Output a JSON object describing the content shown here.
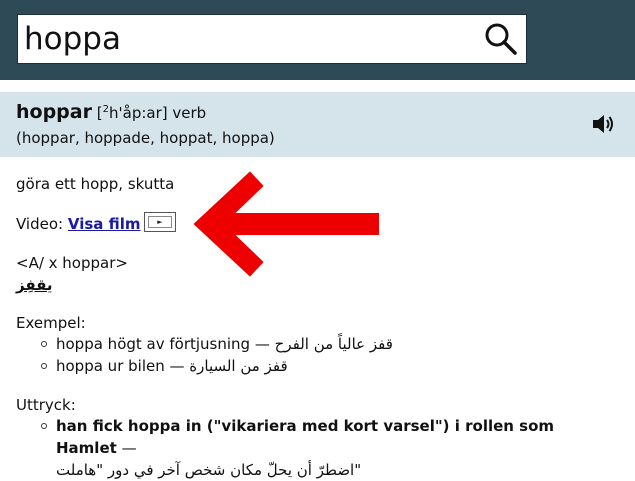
{
  "search": {
    "value": "hoppa",
    "placeholder": ""
  },
  "entry": {
    "headword": "hoppar",
    "pron_open": "[",
    "pron_sup": "2",
    "pron_rest": "h'åp:ar]",
    "pos": "verb",
    "inflections": "(hoppar, hoppade, hoppat, hoppa)"
  },
  "definition": "göra ett hopp, skutta",
  "video": {
    "label": "Video:",
    "link": "Visa film"
  },
  "valency": "<A/ x hoppar>",
  "translation": "يقفِز",
  "examples": {
    "heading": "Exempel:",
    "items": [
      {
        "sv": "hoppa högt av förtjusning —",
        "ar": "قفز عالياً من الفرح"
      },
      {
        "sv": "hoppa ur bilen —",
        "ar": "قفز من السيارة"
      }
    ]
  },
  "idioms": {
    "heading": "Uttryck:",
    "items": [
      {
        "sv": "han fick hoppa in (\"vikariera med kort varsel\") i rollen som Hamlet",
        "sep": " —",
        "ar": "اضطرّ أن يحلّ مكان شخص آخر في دور \"هاملت\""
      }
    ]
  },
  "colors": {
    "topbar": "#2e4a57",
    "header_bg": "#d4e4ea",
    "arrow": "#ee0000",
    "link": "#1a1aa6"
  },
  "icons": {
    "search": "magnifier-icon",
    "speaker": "speaker-icon",
    "film": "film-icon",
    "arrow": "red-arrow"
  }
}
